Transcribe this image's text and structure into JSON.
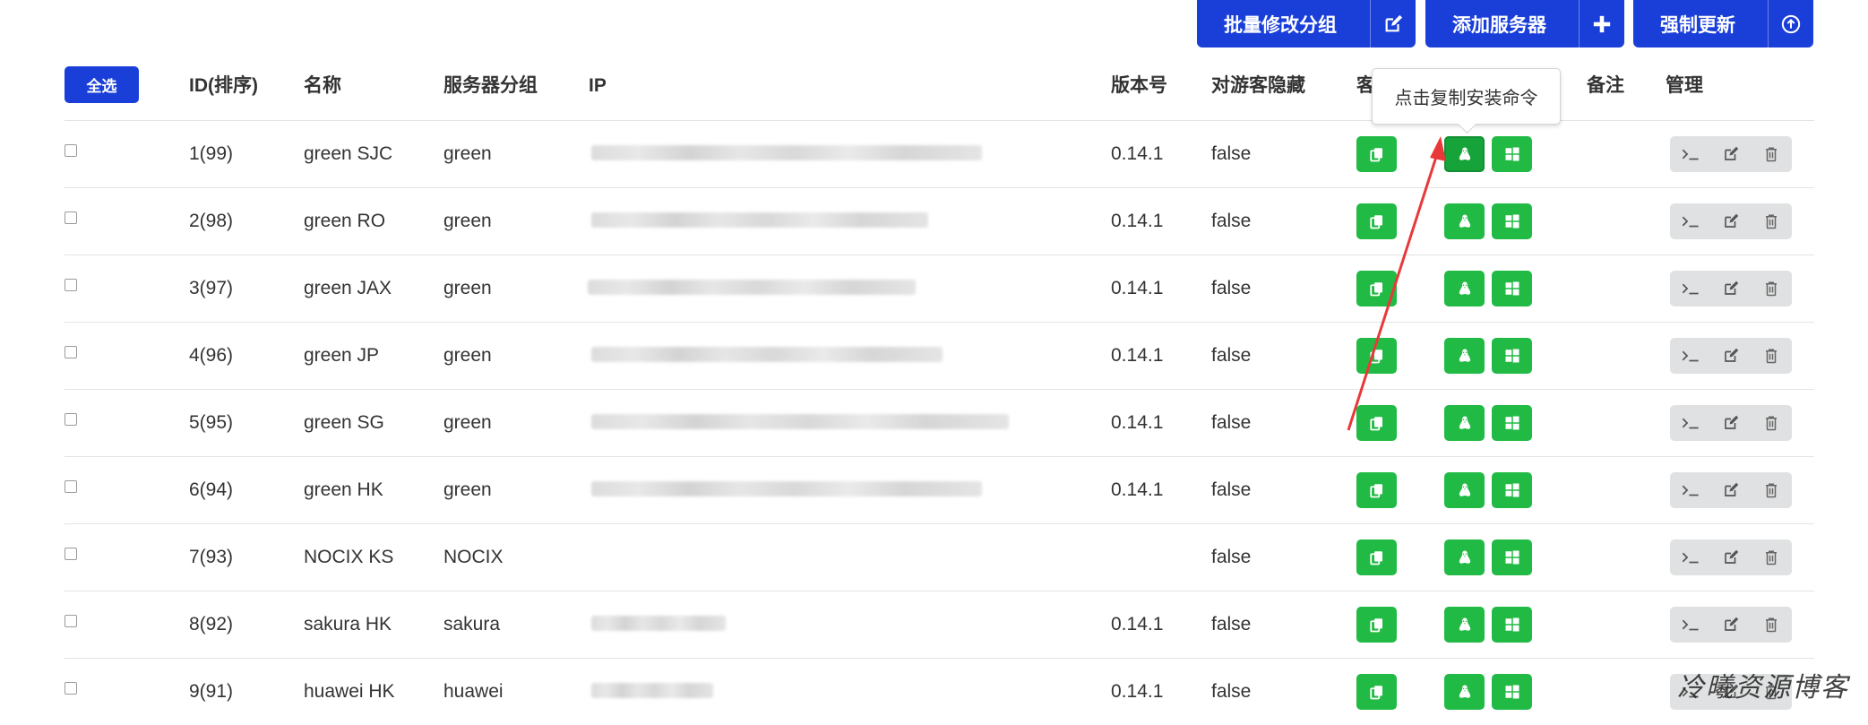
{
  "toolbar": {
    "batch_edit_group": "批量修改分组",
    "add_server": "添加服务器",
    "force_update": "强制更新"
  },
  "table": {
    "select_all": "全选",
    "headers": {
      "id": "ID(排序)",
      "name": "名称",
      "group": "服务器分组",
      "ip": "IP",
      "version": "版本号",
      "hide_guest": "对游客隐藏",
      "client": "客",
      "note": "备注",
      "manage": "管理"
    },
    "rows": [
      {
        "id": "1(99)",
        "name": "green SJC",
        "group": "green",
        "version": "0.14.1",
        "hidden": "false"
      },
      {
        "id": "2(98)",
        "name": "green RO",
        "group": "green",
        "version": "0.14.1",
        "hidden": "false"
      },
      {
        "id": "3(97)",
        "name": "green JAX",
        "group": "green",
        "version": "0.14.1",
        "hidden": "false"
      },
      {
        "id": "4(96)",
        "name": "green JP",
        "group": "green",
        "version": "0.14.1",
        "hidden": "false"
      },
      {
        "id": "5(95)",
        "name": "green SG",
        "group": "green",
        "version": "0.14.1",
        "hidden": "false"
      },
      {
        "id": "6(94)",
        "name": "green HK",
        "group": "green",
        "version": "0.14.1",
        "hidden": "false"
      },
      {
        "id": "7(93)",
        "name": "NOCIX KS",
        "group": "NOCIX",
        "version": "",
        "hidden": "false"
      },
      {
        "id": "8(92)",
        "name": "sakura HK",
        "group": "sakura",
        "version": "0.14.1",
        "hidden": "false"
      },
      {
        "id": "9(91)",
        "name": "huawei HK",
        "group": "huawei",
        "version": "0.14.1",
        "hidden": "false"
      }
    ]
  },
  "tooltip": "点击复制安装命令",
  "watermark": "冷曦资源博客",
  "colors": {
    "primary": "#1a3fd9",
    "success": "#21ba45",
    "annotation_arrow": "#e8393a"
  },
  "icons": [
    "edit-icon",
    "plus-icon",
    "upload-circle-icon",
    "copy-icon",
    "linux-icon",
    "windows-icon",
    "terminal-icon",
    "edit-icon",
    "trash-icon"
  ]
}
